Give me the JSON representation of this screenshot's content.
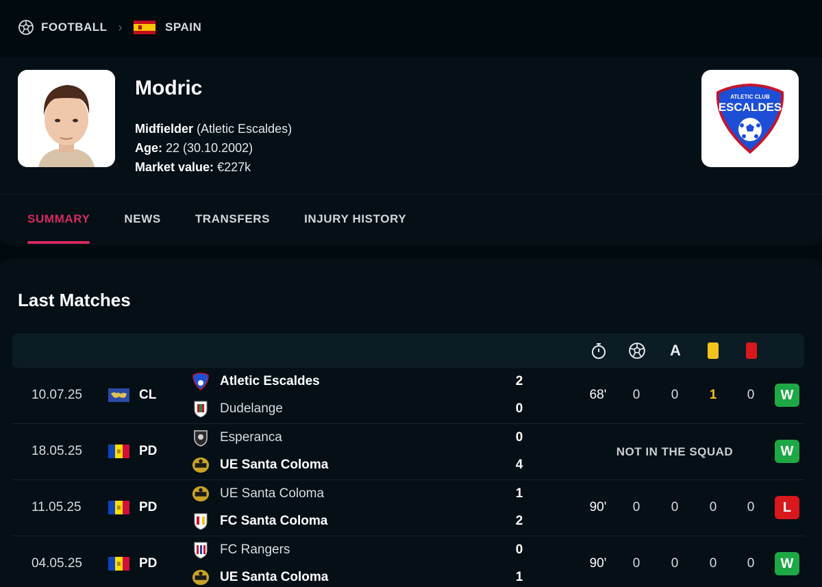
{
  "breadcrumb": {
    "sport": "FOOTBALL",
    "country": "SPAIN",
    "sport_icon": "football-icon",
    "separator_icon": "chevron-right-icon",
    "country_flag": "spain-flag-icon"
  },
  "player": {
    "name": "Modric",
    "position": "Midfielder",
    "club_paren": "(Atletic Escaldes)",
    "age_label": "Age:",
    "age_value": "22 (30.10.2002)",
    "market_label": "Market value:",
    "market_value": "€227k"
  },
  "club_logo": {
    "line1": "ATLETIC CLUB",
    "line2": "ESCALDES",
    "colors": {
      "shield": "#1d4fd6",
      "border": "#c2162f"
    }
  },
  "tabs": [
    {
      "label": "SUMMARY",
      "active": true
    },
    {
      "label": "NEWS",
      "active": false
    },
    {
      "label": "TRANSFERS",
      "active": false
    },
    {
      "label": "INJURY HISTORY",
      "active": false
    }
  ],
  "last_matches": {
    "title": "Last Matches",
    "header_icons": [
      "stopwatch-icon",
      "goals-icon",
      "assist-icon",
      "yellow-card-icon",
      "red-card-icon"
    ],
    "assist_letter": "A",
    "matches": [
      {
        "date": "10.07.25",
        "flag": "champions-league-icon",
        "competition": "CL",
        "home": {
          "name": "Atletic Escaldes",
          "score": "2",
          "winner": true,
          "logo": "atletic-escaldes-logo"
        },
        "away": {
          "name": "Dudelange",
          "score": "0",
          "winner": false,
          "logo": "dudelange-logo"
        },
        "minutes": "68'",
        "goals": "0",
        "assists": "0",
        "yellow": "1",
        "red": "0",
        "not_in_squad": null,
        "result": "W"
      },
      {
        "date": "18.05.25",
        "flag": "andorra-flag-icon",
        "competition": "PD",
        "home": {
          "name": "Esperanca",
          "score": "0",
          "winner": false,
          "logo": "esperanca-logo"
        },
        "away": {
          "name": "UE Santa Coloma",
          "score": "4",
          "winner": true,
          "logo": "ue-santa-coloma-logo"
        },
        "minutes": null,
        "goals": null,
        "assists": null,
        "yellow": null,
        "red": null,
        "not_in_squad": "NOT IN THE SQUAD",
        "result": "W"
      },
      {
        "date": "11.05.25",
        "flag": "andorra-flag-icon",
        "competition": "PD",
        "home": {
          "name": "UE Santa Coloma",
          "score": "1",
          "winner": false,
          "logo": "ue-santa-coloma-logo"
        },
        "away": {
          "name": "FC Santa Coloma",
          "score": "2",
          "winner": true,
          "logo": "fc-santa-coloma-logo"
        },
        "minutes": "90'",
        "goals": "0",
        "assists": "0",
        "yellow": "0",
        "red": "0",
        "not_in_squad": null,
        "result": "L"
      },
      {
        "date": "04.05.25",
        "flag": "andorra-flag-icon",
        "competition": "PD",
        "home": {
          "name": "FC Rangers",
          "score": "0",
          "winner": false,
          "logo": "fc-rangers-logo"
        },
        "away": {
          "name": "UE Santa Coloma",
          "score": "1",
          "winner": true,
          "logo": "ue-santa-coloma-logo"
        },
        "minutes": "90'",
        "goals": "0",
        "assists": "0",
        "yellow": "0",
        "red": "0",
        "not_in_squad": null,
        "result": "W"
      }
    ]
  },
  "colors": {
    "background": "#010a0f",
    "accent": "#d42a60",
    "win": "#1da845",
    "loss": "#d7191d",
    "yellow_card": "#f2c31d",
    "red_card": "#d7191d"
  }
}
